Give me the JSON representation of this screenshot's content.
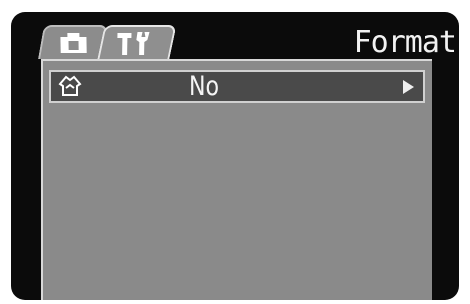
{
  "header": {
    "title": "Format"
  },
  "tabs": [
    {
      "id": "camera",
      "icon": "camera-icon",
      "selected": false
    },
    {
      "id": "setup",
      "icon": "setup-tools-icon",
      "selected": true
    }
  ],
  "menu": {
    "items": [
      {
        "icon": "format-card-icon",
        "value": "No",
        "arrow": "right-arrow-icon"
      }
    ]
  },
  "colors": {
    "screen": "#0b0b0b",
    "panel": "#8a8a8a",
    "selected_row": "#4a4a4a",
    "text": "#f2f2f2"
  }
}
